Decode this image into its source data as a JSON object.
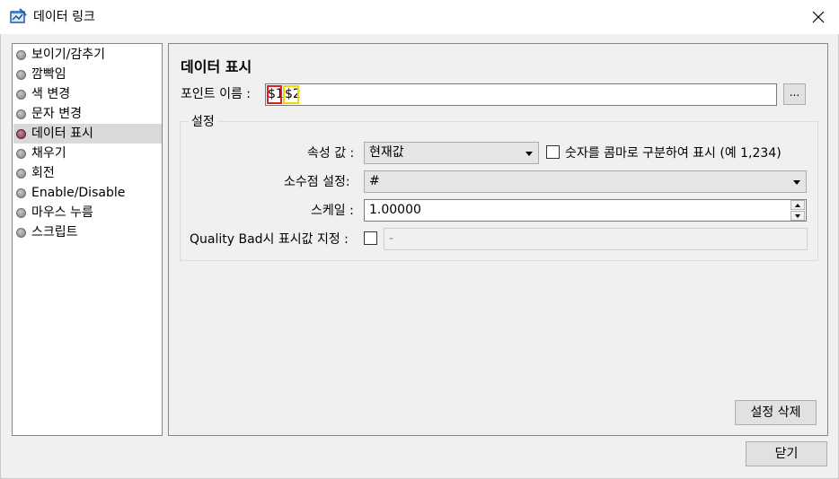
{
  "window": {
    "title": "데이터 링크"
  },
  "sidebar": {
    "items": [
      {
        "label": "보이기/감추기",
        "selected": false
      },
      {
        "label": "깜빡임",
        "selected": false
      },
      {
        "label": "색 변경",
        "selected": false
      },
      {
        "label": "문자 변경",
        "selected": false
      },
      {
        "label": "데이터 표시",
        "selected": true
      },
      {
        "label": "채우기",
        "selected": false
      },
      {
        "label": "회전",
        "selected": false
      },
      {
        "label": "Enable/Disable",
        "selected": false
      },
      {
        "label": "마우스 누름",
        "selected": false
      },
      {
        "label": "스크립트",
        "selected": false
      }
    ]
  },
  "panel": {
    "title": "데이터 표시",
    "point_name_label": "포인트 이름 :",
    "point_name_part1": "$1",
    "point_name_sep": ".",
    "point_name_part2": "$2",
    "browse_label": "...",
    "settings_legend": "설정",
    "attribute_label": "속성 값 :",
    "attribute_value": "현재값",
    "comma_checkbox_label": "숫자를 콤마로 구분하여 표시 (예 1,234)",
    "comma_checked": false,
    "decimal_label": "소수점 설정:",
    "decimal_value": "#",
    "scale_label": "스케일 :",
    "scale_value": "1.00000",
    "quality_label": "Quality Bad시 표시값 지정 :",
    "quality_checked": false,
    "quality_value": "-",
    "delete_settings_label": "설정 삭제"
  },
  "footer": {
    "close_label": "닫기"
  },
  "colors": {
    "highlight_red": "#e02020",
    "highlight_yellow": "#f2d600",
    "active_bullet": "#7a2d4c"
  }
}
